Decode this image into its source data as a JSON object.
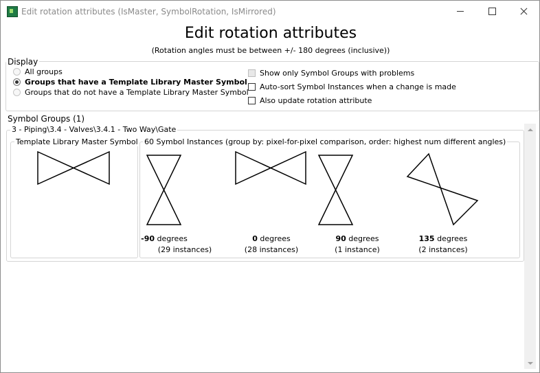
{
  "window": {
    "title": "Edit rotation attributes (IsMaster, SymbolRotation, IsMirrored)"
  },
  "header": {
    "title": "Edit rotation attributes",
    "subtitle": "(Rotation angles must be between +/- 180 degrees (inclusive))"
  },
  "display": {
    "legend": "Display",
    "radios": [
      {
        "label": "All groups",
        "selected": false
      },
      {
        "label": "Groups that have a Template Library Master Symbol",
        "selected": true
      },
      {
        "label": "Groups that do not have a Template Library Master Symbol",
        "selected": false
      }
    ],
    "checkboxes": [
      {
        "label": "Show only Symbol Groups with problems",
        "checked": false,
        "enabled": false
      },
      {
        "label": "Auto-sort Symbol Instances when a change is made",
        "checked": false,
        "enabled": true
      },
      {
        "label": "Also update rotation attribute",
        "checked": false,
        "enabled": true
      }
    ]
  },
  "symbol_groups": {
    "label": "Symbol Groups (1)",
    "group": {
      "path": "3 - Piping\\3.4 - Valves\\3.4.1 - Two Way\\Gate",
      "master_legend": "Template Library Master Symbol",
      "instances_legend": "60 Symbol Instances (group by: pixel-for-pixel comparison, order: highest num different angles)",
      "instances": [
        {
          "angle": "-90",
          "unit": " degrees",
          "count": "(29 instances)"
        },
        {
          "angle": "0",
          "unit": " degrees",
          "count": "(28 instances)"
        },
        {
          "angle": "90",
          "unit": " degrees",
          "count": "(1 instance)"
        },
        {
          "angle": "135",
          "unit": " degrees",
          "count": "(2 instances)"
        }
      ]
    }
  }
}
